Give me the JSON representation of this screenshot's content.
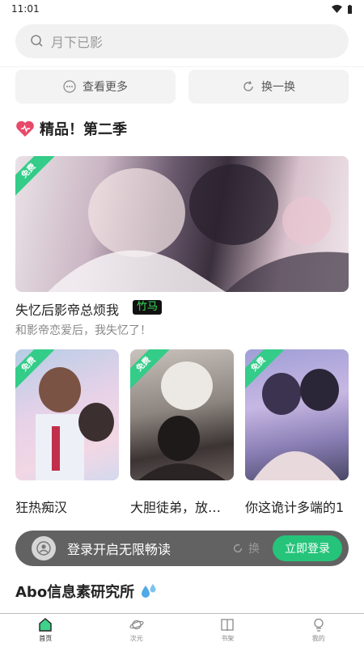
{
  "status": {
    "time": "11:01"
  },
  "search": {
    "placeholder": "月下已影"
  },
  "actions": {
    "more": "查看更多",
    "refresh": "换一换"
  },
  "section1": {
    "title": "精品！第二季",
    "featured": {
      "free": "免费",
      "title": "失忆后影帝总烦我",
      "badge": "竹马",
      "subtitle": "和影帝恋爱后，我失忆了！"
    },
    "items": [
      {
        "free": "免费",
        "title": "狂热痴汉"
      },
      {
        "free": "免费",
        "title": "大胆徒弟，放…"
      },
      {
        "free": "免费",
        "title": "你这诡计多端的1"
      }
    ]
  },
  "login_banner": {
    "text": "登录开启无限畅读",
    "button": "立即登录",
    "peek": "换"
  },
  "section2": {
    "title": "Abo信息素研究所"
  },
  "nav": [
    {
      "label": "首页"
    },
    {
      "label": "次元"
    },
    {
      "label": "书架"
    },
    {
      "label": "我的"
    }
  ],
  "colors": {
    "accent": "#25c47a",
    "free_tag": "#33cc88",
    "badge_text": "#38e05a"
  }
}
